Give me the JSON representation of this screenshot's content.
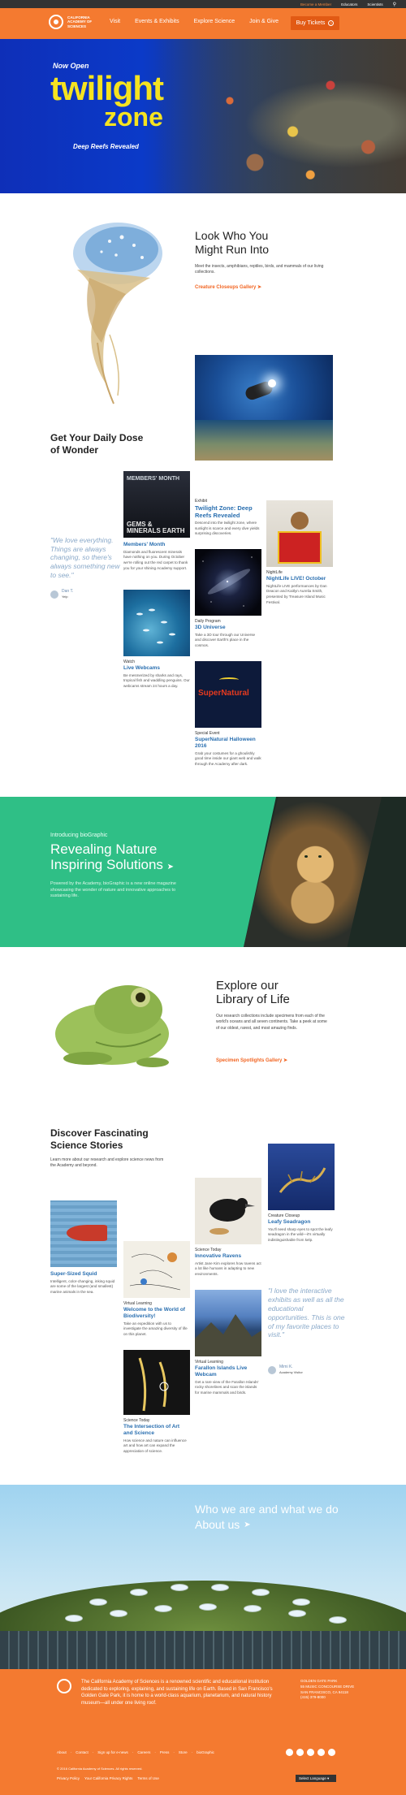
{
  "topbar": {
    "member": "Become a Member",
    "educators": "Educators",
    "scientists": "Scientists"
  },
  "header": {
    "logo_text": "CALIFORNIA ACADEMY OF SCIENCES",
    "nav": [
      "Visit",
      "Events & Exhibits",
      "Explore Science",
      "Join & Give"
    ],
    "buy": "Buy Tickets"
  },
  "hero": {
    "kicker": "Now Open",
    "title1": "twilight",
    "title2": "zone",
    "subtitle": "Deep Reefs Revealed"
  },
  "look": {
    "title_line1": "Look Who You",
    "title_line2": "Might Run Into",
    "desc": "Meet the insects, amphibians, reptiles, birds, and mammals of our living collections.",
    "link": "Creature Closeups Gallery"
  },
  "wonder": {
    "title_line1": "Get Your Daily Dose",
    "title_line2": "of Wonder"
  },
  "quote1": {
    "text": "\"We love everything. Things are always changing, so there's always something new to see.\"",
    "author": "Dan T.",
    "role": "Yelp"
  },
  "cards": [
    {
      "category": "",
      "title": "Members' Month",
      "desc": "Diamonds and fluorescent minerals have nothing on you. During October we're rolling out the red carpet to thank you for your shining Academy support."
    },
    {
      "category": "Exhibit",
      "title": "Twilight Zone: Deep Reefs Revealed",
      "desc": "Descend into the twilight zone, where sunlight is scarce and every dive yields surprising discoveries."
    },
    {
      "category": "NightLife",
      "title": "NightLife LIVE! October",
      "desc": "NightLife LIVE performances by Dan Deacon and Kaitlyn Aurelia Smith, presented by Treasure Island Music Festival."
    },
    {
      "category": "Daily Program",
      "title": "3D Universe",
      "desc": "Take a 3D tour through our Universe and discover Earth's place in the cosmos."
    },
    {
      "category": "Watch",
      "title": "Live Webcams",
      "desc": "Be mesmerized by sharks and rays, tropical fish and waddling penguins. Our webcams stream 24 hours a day."
    },
    {
      "category": "Special Event",
      "title": "SuperNatural Halloween 2016",
      "desc": "Grab your costumes for a ghoulishly good time inside our giant web and walk through the Academy after dark."
    }
  ],
  "card_images": {
    "members": "MEMBERS' MONTH",
    "earth": "GEMS & MINERALS EARTH",
    "supernatural": "SuperNatural"
  },
  "inspire": {
    "kicker": "Introducing bioGraphic",
    "title_line1": "Revealing Nature",
    "title_line2": "Inspiring Solutions",
    "desc": "Powered by the Academy, bioGraphic is a new online magazine showcasing the wonder of nature and innovative approaches to sustaining life."
  },
  "library": {
    "title_line1": "Explore our",
    "title_line2": "Library of Life",
    "desc": "Our research collections include specimens from each of the world's oceans and all seven continents. Take a peek at some of our oldest, rarest, and most amazing finds.",
    "link": "Specimen Spotlights Gallery"
  },
  "discover": {
    "title_line1": "Discover Fascinating",
    "title_line2": "Science Stories",
    "desc": "Learn more about our research and explore science news from the Academy and beyond."
  },
  "stories": [
    {
      "category": "",
      "title": "Super-Sized Squid",
      "desc": "Intelligent, color-changing, inking squid are some of the largest (and smallest) marine animals in the sea."
    },
    {
      "category": "Virtual Learning",
      "title": "Welcome to the World of Biodiversity!",
      "desc": "Take an expedition with us to investigate the amazing diversity of life on this planet."
    },
    {
      "category": "Science Today",
      "title": "The Intersection of Art and Science",
      "desc": "How science and nature can influence art and how art can expand the appreciation of science."
    },
    {
      "category": "Science Today",
      "title": "Innovative Ravens",
      "desc": "Artist Jane Kim explores how ravens act a lot like humans in adapting to new environments."
    },
    {
      "category": "Virtual Learning",
      "title": "Farallon Islands Live Webcam",
      "desc": "Get a rare view of the Farallon Islands' rocky shorelines and scan the islands for marine mammals and birds."
    },
    {
      "category": "Creature Closeup",
      "title": "Leafy Seadragon",
      "desc": "You'll need sharp eyes to spot the leafy seadragon in the wild—it's virtually indistinguishable from kelp."
    }
  ],
  "quote2": {
    "text": "\"I love the interactive exhibits as well as all the educational opportunities. This is one of my favorite places to visit.\"",
    "author": "Mimi K.",
    "role": "Academy Visitor"
  },
  "about": {
    "line1": "Who we are and what we do",
    "line2": "About us"
  },
  "footer": {
    "mission": "The California Academy of Sciences is a renowned scientific and educational institution dedicated to exploring, explaining, and sustaining life on Earth. Based in San Francisco's Golden Gate Park, it is home to a world-class aquarium, planetarium, and natural history museum—all under one living roof.",
    "address": [
      "GOLDEN GATE PARK",
      "55 MUSIC CONCOURSE DRIVE",
      "SAN FRANCISCO, CA 94118",
      "(415) 379-8000"
    ],
    "links": [
      "About",
      "Contact",
      "Sign up for e-news",
      "Careers",
      "Press",
      "Store",
      "bioGraphic"
    ],
    "copyright": "© 2016 California Academy of Sciences. All rights reserved.",
    "legal": [
      "Privacy Policy",
      "Your California Privacy Rights",
      "Terms of Use"
    ],
    "language": "Select Language"
  },
  "colors": {
    "brand_orange": "#f47a30",
    "teal": "#2fbf86",
    "link_blue": "#2a6fb0",
    "hero_yellow": "#f5e320"
  }
}
